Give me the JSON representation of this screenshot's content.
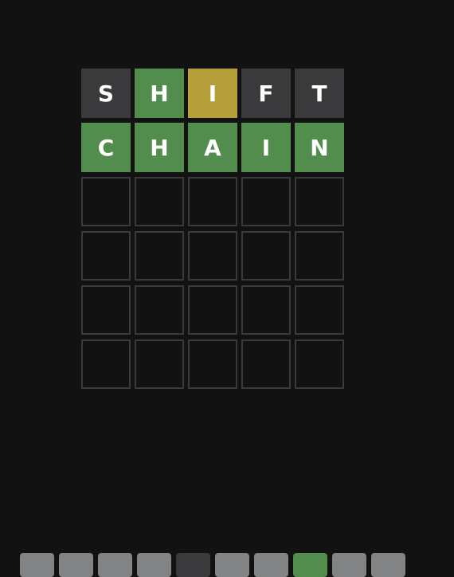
{
  "colors": {
    "background": "#121213",
    "absent": "#3a3a3c",
    "present": "#b59f3b",
    "correct": "#538d4e",
    "key_default": "#818384",
    "empty_border": "#3a3a3c"
  },
  "board": {
    "rows": [
      [
        {
          "letter": "S",
          "state": "absent"
        },
        {
          "letter": "H",
          "state": "correct"
        },
        {
          "letter": "I",
          "state": "present"
        },
        {
          "letter": "F",
          "state": "absent"
        },
        {
          "letter": "T",
          "state": "absent"
        }
      ],
      [
        {
          "letter": "C",
          "state": "correct"
        },
        {
          "letter": "H",
          "state": "correct"
        },
        {
          "letter": "A",
          "state": "correct"
        },
        {
          "letter": "I",
          "state": "correct"
        },
        {
          "letter": "N",
          "state": "correct"
        }
      ],
      [
        {
          "letter": "",
          "state": "empty"
        },
        {
          "letter": "",
          "state": "empty"
        },
        {
          "letter": "",
          "state": "empty"
        },
        {
          "letter": "",
          "state": "empty"
        },
        {
          "letter": "",
          "state": "empty"
        }
      ],
      [
        {
          "letter": "",
          "state": "empty"
        },
        {
          "letter": "",
          "state": "empty"
        },
        {
          "letter": "",
          "state": "empty"
        },
        {
          "letter": "",
          "state": "empty"
        },
        {
          "letter": "",
          "state": "empty"
        }
      ],
      [
        {
          "letter": "",
          "state": "empty"
        },
        {
          "letter": "",
          "state": "empty"
        },
        {
          "letter": "",
          "state": "empty"
        },
        {
          "letter": "",
          "state": "empty"
        },
        {
          "letter": "",
          "state": "empty"
        }
      ],
      [
        {
          "letter": "",
          "state": "empty"
        },
        {
          "letter": "",
          "state": "empty"
        },
        {
          "letter": "",
          "state": "empty"
        },
        {
          "letter": "",
          "state": "empty"
        },
        {
          "letter": "",
          "state": "empty"
        }
      ]
    ]
  },
  "keyboard": {
    "top_row": [
      {
        "label": "",
        "state": "unused"
      },
      {
        "label": "",
        "state": "unused"
      },
      {
        "label": "",
        "state": "unused"
      },
      {
        "label": "",
        "state": "unused"
      },
      {
        "label": "",
        "state": "absent"
      },
      {
        "label": "",
        "state": "unused"
      },
      {
        "label": "",
        "state": "unused"
      },
      {
        "label": "",
        "state": "correct"
      },
      {
        "label": "",
        "state": "unused"
      },
      {
        "label": "",
        "state": "unused"
      }
    ]
  }
}
